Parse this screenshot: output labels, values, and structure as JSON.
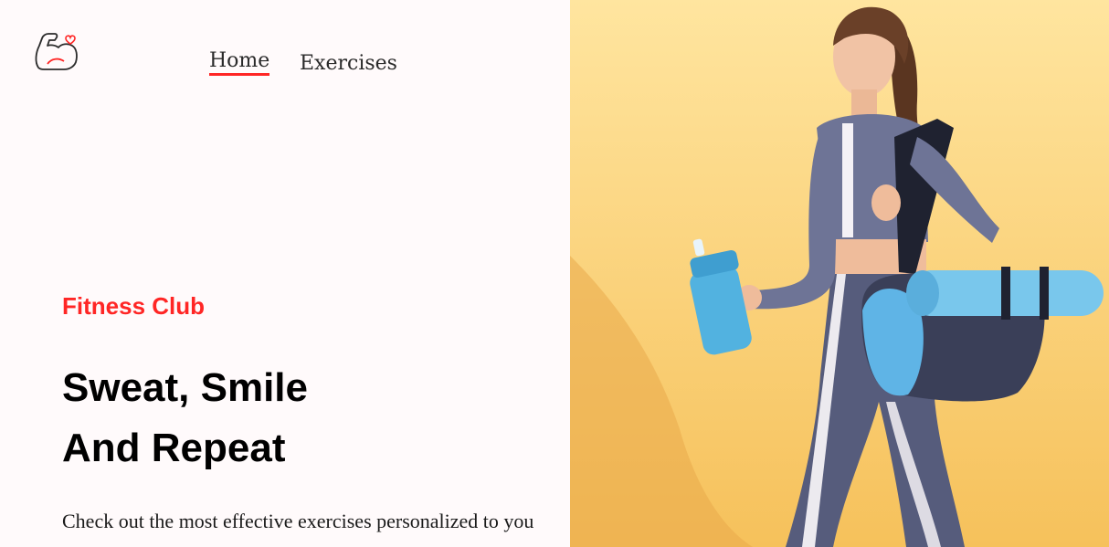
{
  "nav": {
    "logo_icon": "flexed-arm-heart-icon",
    "links": [
      {
        "label": "Home",
        "active": true
      },
      {
        "label": "Exercises",
        "active": false
      }
    ],
    "active_color": "#ff2625"
  },
  "hero": {
    "brand": "Fitness Club",
    "headline_line1": "Sweat, Smile",
    "headline_line2": "And Repeat",
    "subtitle": "Check out the most effective exercises personalized to you",
    "accent_color": "#ff2625"
  },
  "banner": {
    "subject": "woman-walking-with-water-bottle-and-gym-bag",
    "background_color": "#fcd57d"
  }
}
